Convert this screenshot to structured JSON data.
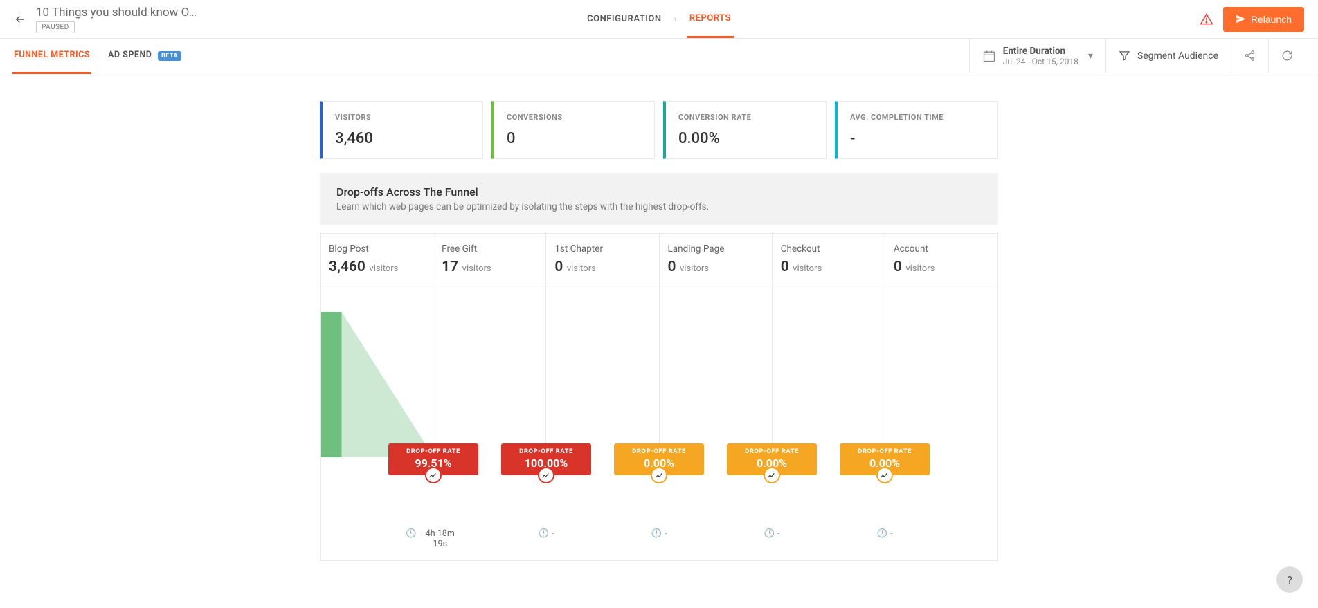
{
  "header": {
    "title": "10 Things you should know O…",
    "status": "PAUSED",
    "nav": {
      "configuration": "CONFIGURATION",
      "reports": "REPORTS"
    },
    "relaunch": "Relaunch"
  },
  "subbar": {
    "tabs": {
      "funnel_metrics": "FUNNEL METRICS",
      "ad_spend": "AD SPEND",
      "beta": "BETA"
    },
    "duration": {
      "label": "Entire Duration",
      "range": "Jul 24 - Oct 15, 2018"
    },
    "segment": "Segment Audience"
  },
  "metrics": [
    {
      "label": "VISITORS",
      "value": "3,460",
      "color": "c-blue"
    },
    {
      "label": "CONVERSIONS",
      "value": "0",
      "color": "c-green"
    },
    {
      "label": "CONVERSION RATE",
      "value": "0.00%",
      "color": "c-teal"
    },
    {
      "label": "AVG. COMPLETION TIME",
      "value": "-",
      "color": "c-cyan"
    }
  ],
  "panel": {
    "title": "Drop-offs Across The Funnel",
    "subtitle": "Learn which web pages can be optimized by isolating the steps with the highest drop-offs."
  },
  "chart_data": {
    "type": "bar",
    "categories": [
      "Blog Post",
      "Free Gift",
      "1st Chapter",
      "Landing Page",
      "Checkout",
      "Account"
    ],
    "series": [
      {
        "name": "visitors",
        "values": [
          3460,
          17,
          0,
          0,
          0,
          0
        ]
      }
    ],
    "title": "Drop-offs Across The Funnel",
    "xlabel": "",
    "ylabel": "visitors",
    "ylim": [
      0,
      3460
    ]
  },
  "funnel": {
    "visitors_label": "visitors",
    "steps": [
      {
        "name": "Blog Post",
        "count": "3,460"
      },
      {
        "name": "Free Gift",
        "count": "17"
      },
      {
        "name": "1st Chapter",
        "count": "0"
      },
      {
        "name": "Landing Page",
        "count": "0"
      },
      {
        "name": "Checkout",
        "count": "0"
      },
      {
        "name": "Account",
        "count": "0"
      }
    ],
    "dropoffs": [
      {
        "label": "DROP-OFF RATE",
        "value": "99.51%",
        "color": "red",
        "time": "4h 18m 19s"
      },
      {
        "label": "DROP-OFF RATE",
        "value": "100.00%",
        "color": "red",
        "time": "-"
      },
      {
        "label": "DROP-OFF RATE",
        "value": "0.00%",
        "color": "orange",
        "time": "-"
      },
      {
        "label": "DROP-OFF RATE",
        "value": "0.00%",
        "color": "orange",
        "time": "-"
      },
      {
        "label": "DROP-OFF RATE",
        "value": "0.00%",
        "color": "orange",
        "time": "-"
      }
    ]
  },
  "help": "?"
}
